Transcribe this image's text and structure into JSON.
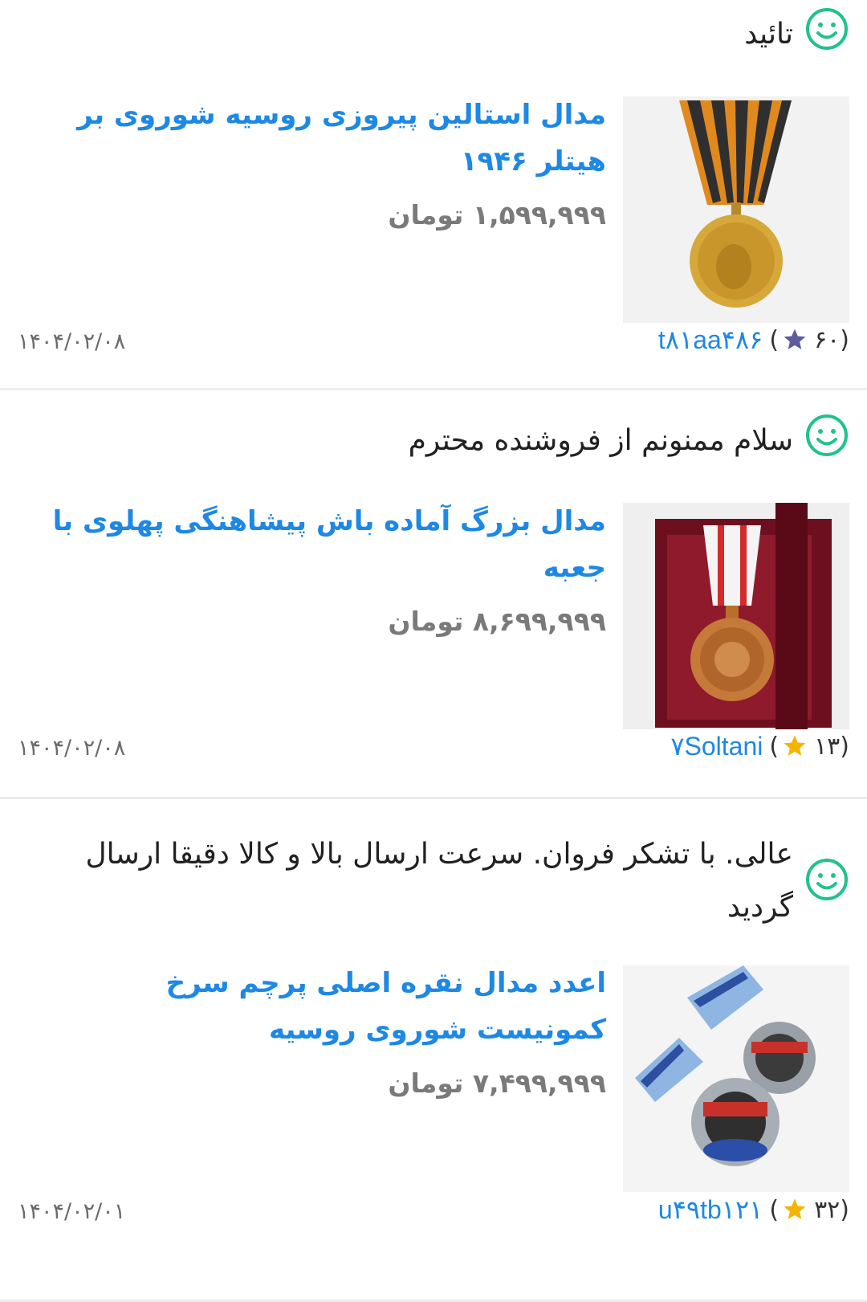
{
  "reviews": [
    {
      "comment": "تائید",
      "product_title": "مدال استالین پیروزی روسیه شوروی بر هیتلر ۱۹۴۶",
      "price": "۱,۵۹۹,۹۹۹ تومان",
      "seller_name": "t۸۱aa۴۸۶",
      "seller_open": "(",
      "seller_score": "۶۰)",
      "star_color": "#5c5c9e",
      "date": "۱۴۰۴/۰۲/۰۸"
    },
    {
      "comment": "سلام ممنونم از فروشنده محترم",
      "product_title": "مدال بزرگ آماده باش پیشاهنگی پهلوی با جعبه",
      "price": "۸,۶۹۹,۹۹۹ تومان",
      "seller_name": "۷Soltani",
      "seller_open": "(",
      "seller_score": "۱۳)",
      "star_color": "#f5b400",
      "date": "۱۴۰۴/۰۲/۰۸"
    },
    {
      "comment": "عالی. با تشکر فروان. سرعت ارسال بالا و کالا دقیقا ارسال گردید",
      "product_title": "اعدد مدال نقره اصلی پرچم سرخ کمونیست شوروی روسیه",
      "price": "۷,۴۹۹,۹۹۹ تومان",
      "seller_name": "u۴۹tb۱۲۱",
      "seller_open": "(",
      "seller_score": "۳۲)",
      "star_color": "#f5b400",
      "date": "۱۴۰۴/۰۲/۰۱"
    }
  ],
  "colors": {
    "accent": "#1e88e5",
    "smile": "#21c28a",
    "divider": "#ececec"
  }
}
